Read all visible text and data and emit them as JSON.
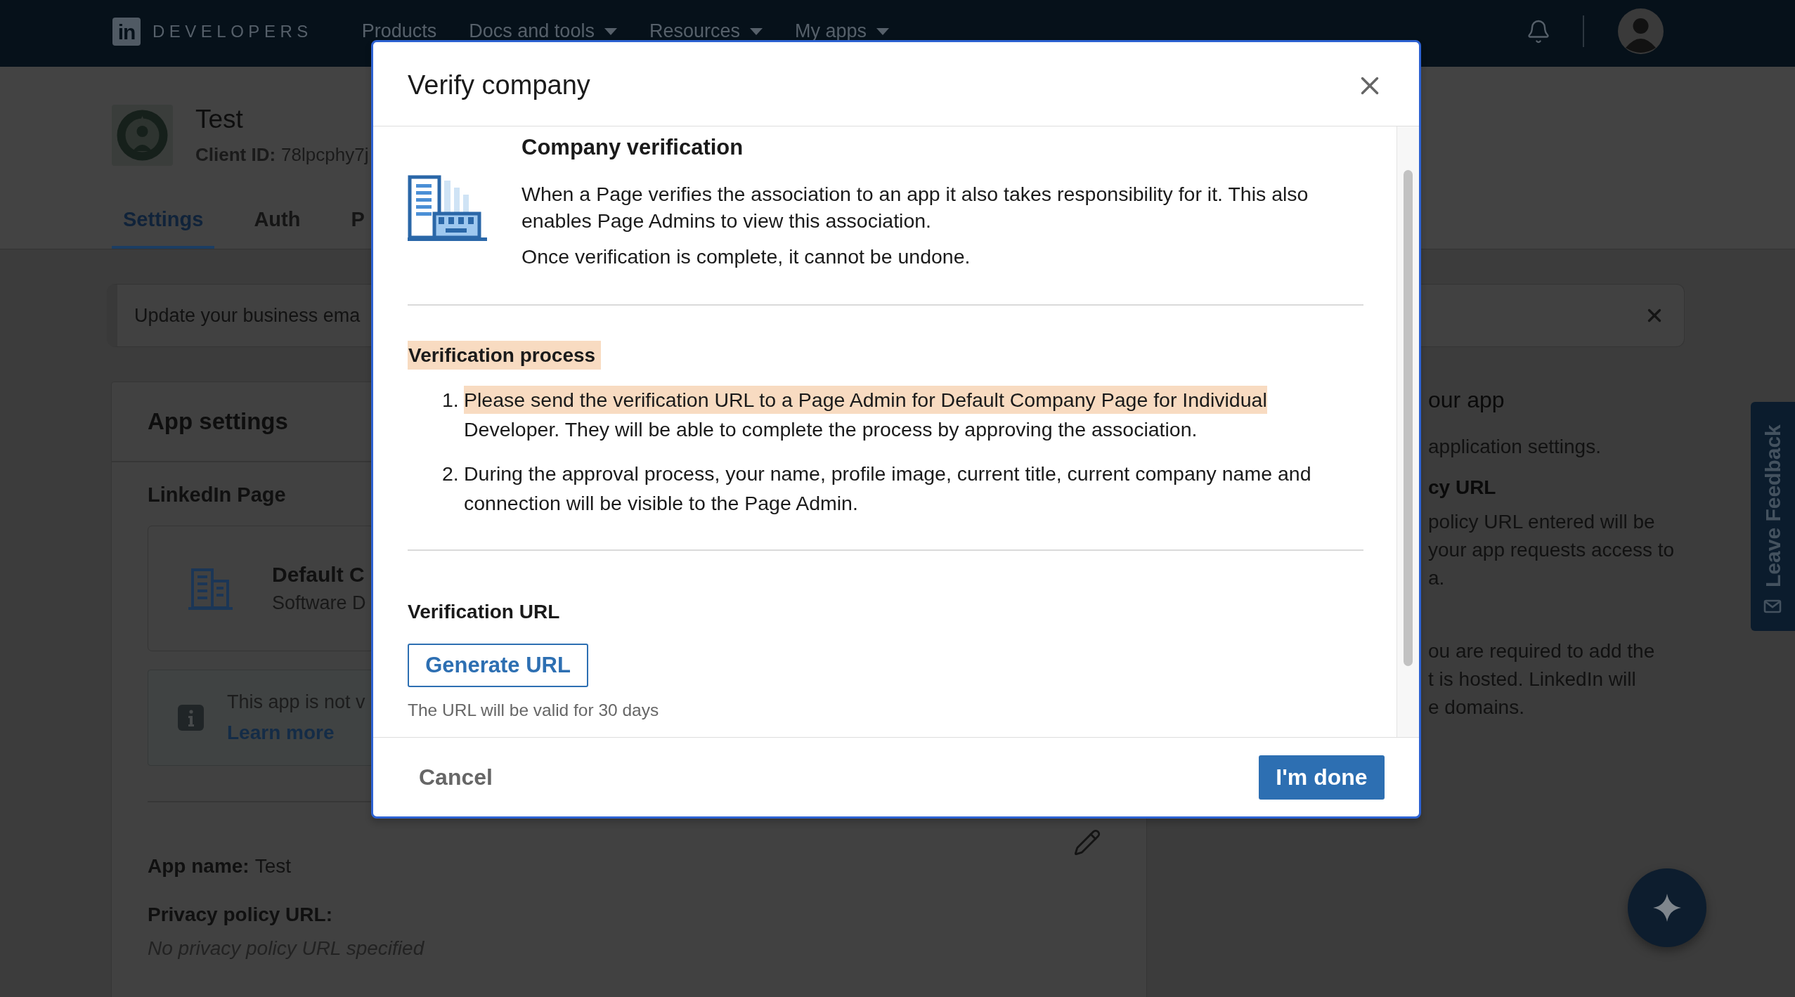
{
  "nav": {
    "logo_mark": "in",
    "brand": "DEVELOPERS",
    "items": [
      {
        "label": "Products",
        "dropdown": false
      },
      {
        "label": "Docs and tools",
        "dropdown": true
      },
      {
        "label": "Resources",
        "dropdown": true
      },
      {
        "label": "My apps",
        "dropdown": true
      }
    ]
  },
  "app_header": {
    "name": "Test",
    "client_id_label": "Client ID:",
    "client_id": "78lpcphy7j"
  },
  "tabs": [
    {
      "label": "Settings",
      "selected": true
    },
    {
      "label": "Auth",
      "selected": false
    },
    {
      "label": "P",
      "selected": false
    }
  ],
  "banner": {
    "text": "Update your business ema"
  },
  "app_settings": {
    "title": "App settings",
    "linkedin_page": {
      "label": "LinkedIn Page",
      "name": "Default C",
      "category": "Software D"
    },
    "notice": {
      "text": "This app is not v",
      "link": "Learn more"
    },
    "fields": [
      {
        "kind": "inline",
        "label": "App name:",
        "value": "Test",
        "empty": false
      },
      {
        "kind": "stacked",
        "label": "Privacy policy URL:",
        "value": "No privacy policy URL specified",
        "empty": true
      }
    ]
  },
  "side_panel": [
    {
      "kind": "heading",
      "lines": [
        "our app"
      ]
    },
    {
      "kind": "text",
      "lines": [
        "application settings."
      ]
    },
    {
      "kind": "subheading",
      "lines": [
        "cy URL"
      ]
    },
    {
      "kind": "text",
      "lines": [
        "policy URL entered will be",
        "your app requests access to",
        "a."
      ]
    },
    {
      "kind": "text",
      "lines": [
        "ou are required to add the",
        "t is hosted. LinkedIn will",
        "e domains."
      ]
    }
  ],
  "feedback_tab": {
    "label": "Leave Feedback"
  },
  "modal": {
    "title": "Verify company",
    "intro": {
      "heading": "Company verification",
      "paragraphs": [
        "When a Page verifies the association to an app it also takes responsibility for it. This also enables Page Admins to view this association.",
        "Once verification is complete, it cannot be undone."
      ]
    },
    "process": {
      "title": "Verification process",
      "highlighted": true,
      "steps": [
        {
          "number": "1.",
          "highlight": "Please send the verification URL to a Page Admin for Default Company Page for Individual",
          "text": "Developer. They will be able to complete the process by approving the association."
        },
        {
          "number": "2.",
          "text": "During the approval process, your name, profile image, current title, current company name and connection will be visible to the Page Admin."
        }
      ]
    },
    "url_section": {
      "title": "Verification URL",
      "button": "Generate URL",
      "note": "The URL will be valid for 30 days"
    },
    "footer": {
      "cancel": "Cancel",
      "confirm": "I'm done"
    }
  }
}
